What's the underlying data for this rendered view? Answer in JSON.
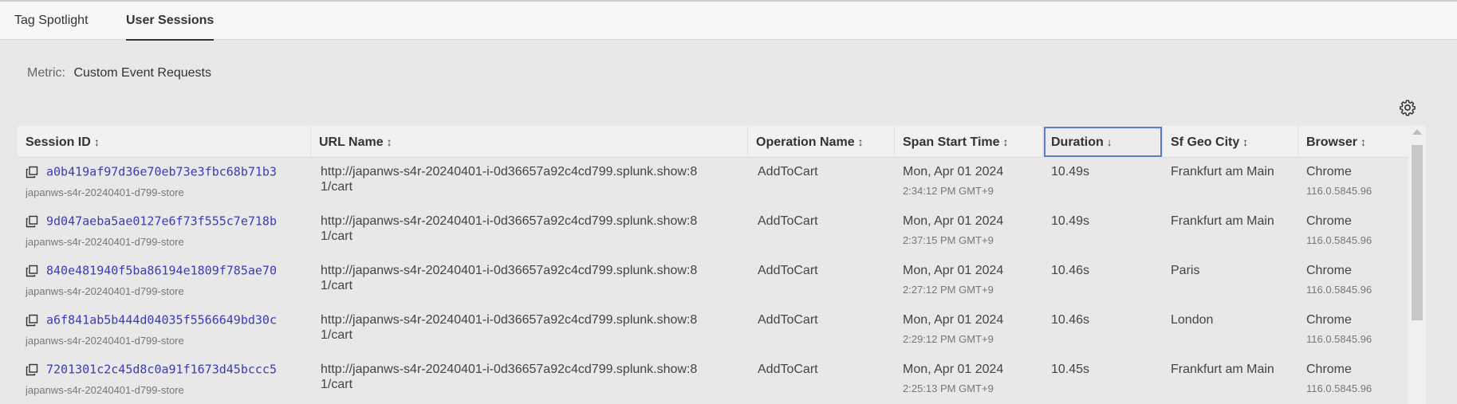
{
  "tabs": [
    {
      "label": "Tag Spotlight",
      "active": false
    },
    {
      "label": "User Sessions",
      "active": true
    }
  ],
  "metric": {
    "label": "Metric:",
    "value": "Custom Event Requests"
  },
  "settings_icon": "gear-icon",
  "table": {
    "columns": [
      {
        "label": "Session ID",
        "sort": "↕"
      },
      {
        "label": "URL Name",
        "sort": "↕"
      },
      {
        "label": "Operation Name",
        "sort": "↕"
      },
      {
        "label": "Span Start Time",
        "sort": "↕"
      },
      {
        "label": "Duration",
        "sort": "↓"
      },
      {
        "label": "Sf Geo City",
        "sort": "↕"
      },
      {
        "label": "Browser",
        "sort": "↕"
      }
    ],
    "rows": [
      {
        "session_id": "a0b419af97d36e70eb73e3fbc68b71b3",
        "app": "japanws-s4r-20240401-d799-store",
        "url": "http://japanws-s4r-20240401-i-0d36657a92c4cd799.splunk.show:81/cart",
        "operation": "AddToCart",
        "date": "Mon, Apr 01 2024",
        "time": "2:34:12 PM GMT+9",
        "duration": "10.49s",
        "city": "Frankfurt am Main",
        "browser": "Chrome",
        "version": "116.0.5845.96"
      },
      {
        "session_id": "9d047aeba5ae0127e6f73f555c7e718b",
        "app": "japanws-s4r-20240401-d799-store",
        "url": "http://japanws-s4r-20240401-i-0d36657a92c4cd799.splunk.show:81/cart",
        "operation": "AddToCart",
        "date": "Mon, Apr 01 2024",
        "time": "2:37:15 PM GMT+9",
        "duration": "10.49s",
        "city": "Frankfurt am Main",
        "browser": "Chrome",
        "version": "116.0.5845.96"
      },
      {
        "session_id": "840e481940f5ba86194e1809f785ae70",
        "app": "japanws-s4r-20240401-d799-store",
        "url": "http://japanws-s4r-20240401-i-0d36657a92c4cd799.splunk.show:81/cart",
        "operation": "AddToCart",
        "date": "Mon, Apr 01 2024",
        "time": "2:27:12 PM GMT+9",
        "duration": "10.46s",
        "city": "Paris",
        "browser": "Chrome",
        "version": "116.0.5845.96"
      },
      {
        "session_id": "a6f841ab5b444d04035f5566649bd30c",
        "app": "japanws-s4r-20240401-d799-store",
        "url": "http://japanws-s4r-20240401-i-0d36657a92c4cd799.splunk.show:81/cart",
        "operation": "AddToCart",
        "date": "Mon, Apr 01 2024",
        "time": "2:29:12 PM GMT+9",
        "duration": "10.46s",
        "city": "London",
        "browser": "Chrome",
        "version": "116.0.5845.96"
      },
      {
        "session_id": "7201301c2c45d8c0a91f1673d45bccc5",
        "app": "japanws-s4r-20240401-d799-store",
        "url": "http://japanws-s4r-20240401-i-0d36657a92c4cd799.splunk.show:81/cart",
        "operation": "AddToCart",
        "date": "Mon, Apr 01 2024",
        "time": "2:25:13 PM GMT+9",
        "duration": "10.45s",
        "city": "Frankfurt am Main",
        "browser": "Chrome",
        "version": "116.0.5845.96"
      }
    ]
  },
  "colors": {
    "link": "#3b3bb8",
    "active_header_outline": "#5a7ad0",
    "background": "#e8e8e8"
  }
}
